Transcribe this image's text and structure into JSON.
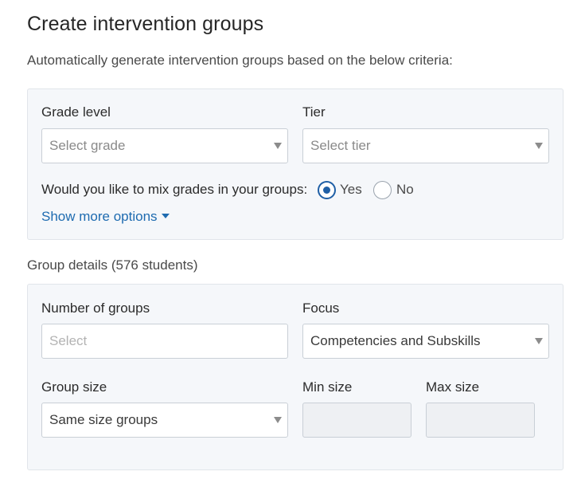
{
  "page": {
    "title": "Create intervention groups",
    "intro": "Automatically generate intervention groups based on the below criteria:"
  },
  "criteria": {
    "grade_label": "Grade level",
    "grade_placeholder": "Select grade",
    "tier_label": "Tier",
    "tier_placeholder": "Select tier",
    "mix_question": "Would you like to mix grades in your groups:",
    "mix_options": [
      {
        "label": "Yes",
        "selected": true
      },
      {
        "label": "No",
        "selected": false
      }
    ],
    "more_options_label": "Show more options"
  },
  "details": {
    "heading": "Group details (576 students)",
    "num_groups_label": "Number of groups",
    "num_groups_placeholder": "Select",
    "focus_label": "Focus",
    "focus_value": "Competencies and Subskills",
    "group_size_label": "Group size",
    "group_size_value": "Same size groups",
    "min_size_label": "Min size",
    "max_size_label": "Max size"
  },
  "icons": {
    "select_caret": "chevron-down-icon",
    "more_caret": "caret-down-icon"
  },
  "colors": {
    "accent": "#1f5fa6",
    "link": "#1e6bb0",
    "panel_bg": "#f5f7fa"
  }
}
